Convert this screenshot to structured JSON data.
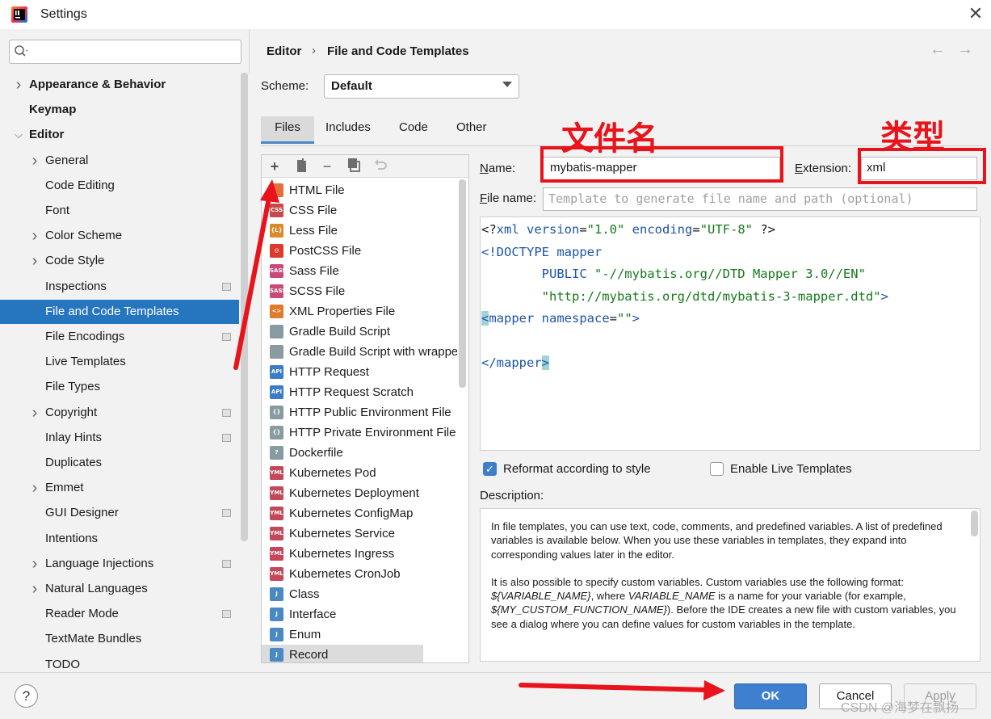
{
  "window": {
    "title": "Settings"
  },
  "search": {
    "placeholder": ""
  },
  "sidebar": {
    "items": [
      {
        "label": "Appearance & Behavior",
        "chevron": true,
        "bold": true,
        "indent": 0,
        "project": false
      },
      {
        "label": "Keymap",
        "chevron": false,
        "bold": true,
        "indent": 0,
        "project": false
      },
      {
        "label": "Editor",
        "chevron": "open",
        "bold": true,
        "indent": 0,
        "project": false
      },
      {
        "label": "General",
        "chevron": true,
        "bold": false,
        "indent": 1,
        "project": false
      },
      {
        "label": "Code Editing",
        "chevron": false,
        "bold": false,
        "indent": 1,
        "project": false
      },
      {
        "label": "Font",
        "chevron": false,
        "bold": false,
        "indent": 1,
        "project": false
      },
      {
        "label": "Color Scheme",
        "chevron": true,
        "bold": false,
        "indent": 1,
        "project": false
      },
      {
        "label": "Code Style",
        "chevron": true,
        "bold": false,
        "indent": 1,
        "project": false
      },
      {
        "label": "Inspections",
        "chevron": false,
        "bold": false,
        "indent": 1,
        "project": true
      },
      {
        "label": "File and Code Templates",
        "chevron": false,
        "bold": false,
        "indent": 1,
        "project": false,
        "selected": true
      },
      {
        "label": "File Encodings",
        "chevron": false,
        "bold": false,
        "indent": 1,
        "project": true
      },
      {
        "label": "Live Templates",
        "chevron": false,
        "bold": false,
        "indent": 1,
        "project": false
      },
      {
        "label": "File Types",
        "chevron": false,
        "bold": false,
        "indent": 1,
        "project": false
      },
      {
        "label": "Copyright",
        "chevron": true,
        "bold": false,
        "indent": 1,
        "project": true
      },
      {
        "label": "Inlay Hints",
        "chevron": false,
        "bold": false,
        "indent": 1,
        "project": true
      },
      {
        "label": "Duplicates",
        "chevron": false,
        "bold": false,
        "indent": 1,
        "project": false
      },
      {
        "label": "Emmet",
        "chevron": true,
        "bold": false,
        "indent": 1,
        "project": false
      },
      {
        "label": "GUI Designer",
        "chevron": false,
        "bold": false,
        "indent": 1,
        "project": true
      },
      {
        "label": "Intentions",
        "chevron": false,
        "bold": false,
        "indent": 1,
        "project": false
      },
      {
        "label": "Language Injections",
        "chevron": true,
        "bold": false,
        "indent": 1,
        "project": true
      },
      {
        "label": "Natural Languages",
        "chevron": true,
        "bold": false,
        "indent": 1,
        "project": false
      },
      {
        "label": "Reader Mode",
        "chevron": false,
        "bold": false,
        "indent": 1,
        "project": true
      },
      {
        "label": "TextMate Bundles",
        "chevron": false,
        "bold": false,
        "indent": 1,
        "project": false
      },
      {
        "label": "TODO",
        "chevron": false,
        "bold": false,
        "indent": 1,
        "project": false
      }
    ]
  },
  "breadcrumb": {
    "parent": "Editor",
    "separator": "›",
    "current": "File and Code Templates"
  },
  "nav": {
    "back": "←",
    "forward": "→"
  },
  "scheme": {
    "label": "Scheme:",
    "value": "Default"
  },
  "tabs": [
    "Files",
    "Includes",
    "Code",
    "Other"
  ],
  "toolbar": {
    "add": "+",
    "remove": "−"
  },
  "templates": [
    {
      "label": "HTML File",
      "icon": "html-file-icon",
      "badge": "",
      "color": "#e4703a"
    },
    {
      "label": "CSS File",
      "icon": "css-file-icon",
      "badge": "CSS",
      "color": "#c74a4a"
    },
    {
      "label": "Less File",
      "icon": "less-file-icon",
      "badge": "{L}",
      "color": "#d98a2b"
    },
    {
      "label": "PostCSS File",
      "icon": "postcss-file-icon",
      "badge": "◎",
      "color": "#dd3a2b"
    },
    {
      "label": "Sass File",
      "icon": "sass-file-icon",
      "badge": "SASS",
      "color": "#c74a7a"
    },
    {
      "label": "SCSS File",
      "icon": "scss-file-icon",
      "badge": "SASS",
      "color": "#c74a7a"
    },
    {
      "label": "XML Properties File",
      "icon": "xml-properties-file-icon",
      "badge": "<>",
      "color": "#e07a2c"
    },
    {
      "label": "Gradle Build Script",
      "icon": "gradle-icon",
      "badge": "",
      "color": "#8a9aa3"
    },
    {
      "label": "Gradle Build Script with wrapper",
      "icon": "gradle-wrapper-icon",
      "badge": "",
      "color": "#8a9aa3"
    },
    {
      "label": "HTTP Request",
      "icon": "http-request-icon",
      "badge": "API",
      "color": "#3b7cc7"
    },
    {
      "label": "HTTP Request Scratch",
      "icon": "http-scratch-icon",
      "badge": "API",
      "color": "#3b7cc7"
    },
    {
      "label": "HTTP Public Environment File",
      "icon": "http-public-env-icon",
      "badge": "{}",
      "color": "#8a9aa3"
    },
    {
      "label": "HTTP Private Environment File",
      "icon": "http-private-env-icon",
      "badge": "{}",
      "color": "#8a9aa3"
    },
    {
      "label": "Dockerfile",
      "icon": "dockerfile-icon",
      "badge": "?",
      "color": "#8a9aa3"
    },
    {
      "label": "Kubernetes Pod",
      "icon": "yaml-file-icon",
      "badge": "YML",
      "color": "#c4485a"
    },
    {
      "label": "Kubernetes Deployment",
      "icon": "yaml-file-icon",
      "badge": "YML",
      "color": "#c4485a"
    },
    {
      "label": "Kubernetes ConfigMap",
      "icon": "yaml-file-icon",
      "badge": "YML",
      "color": "#c4485a"
    },
    {
      "label": "Kubernetes Service",
      "icon": "yaml-file-icon",
      "badge": "YML",
      "color": "#c4485a"
    },
    {
      "label": "Kubernetes Ingress",
      "icon": "yaml-file-icon",
      "badge": "YML",
      "color": "#c4485a"
    },
    {
      "label": "Kubernetes CronJob",
      "icon": "yaml-file-icon",
      "badge": "YML",
      "color": "#c4485a"
    },
    {
      "label": "Class",
      "icon": "java-class-icon",
      "badge": "J",
      "color": "#4a8ac4"
    },
    {
      "label": "Interface",
      "icon": "java-interface-icon",
      "badge": "J",
      "color": "#4a8ac4"
    },
    {
      "label": "Enum",
      "icon": "java-enum-icon",
      "badge": "J",
      "color": "#4a8ac4"
    },
    {
      "label": "Record",
      "icon": "java-record-icon",
      "badge": "J",
      "color": "#4a8ac4",
      "selected": true
    }
  ],
  "form": {
    "name_label": "Name:",
    "name_value": "mybatis-mapper",
    "extension_label": "Extension:",
    "extension_value": "xml",
    "file_name_label": "File name:",
    "file_name_placeholder": "Template to generate file name and path (optional)"
  },
  "code": {
    "line1": {
      "a": "<?",
      "b": "xml version",
      "c": "=",
      "d": "\"1.0\"",
      "e": " encoding",
      "f": "=",
      "g": "\"UTF-8\"",
      "h": " ?>"
    },
    "line2": {
      "a": "<!DOCTYPE mapper"
    },
    "line3": {
      "a": "        PUBLIC ",
      "b": "\"-//mybatis.org//DTD Mapper 3.0//EN\""
    },
    "line4": {
      "a": "        ",
      "b": "\"http://mybatis.org/dtd/mybatis-3-mapper.dtd\"",
      "c": ">"
    },
    "line5": {
      "a": "<",
      "b": "mapper namespace",
      "c": "=",
      "d": "\"\"",
      "e": ">"
    },
    "line6": {
      "a": "</",
      "b": "mapper",
      "c": ">"
    }
  },
  "options": {
    "reformat_label": "Reformat according to style",
    "reformat_checked": true,
    "live_label": "Enable Live Templates",
    "live_checked": false
  },
  "description": {
    "label": "Description:",
    "p1": "In file templates, you can use text, code, comments, and predefined variables. A list of predefined variables is available below. When you use these variables in templates, they expand into corresponding values later in the editor.",
    "p2a": "It is also possible to specify custom variables. Custom variables use the following format: ",
    "p2b": "${VARIABLE_NAME}",
    "p2c": ", where ",
    "p2d": "VARIABLE_NAME",
    "p2e": " is a name for your variable (for example, ",
    "p2f": "${MY_CUSTOM_FUNCTION_NAME}",
    "p2g": "). Before the IDE creates a new file with custom variables, you see a dialog where you can define values for custom variables in the template."
  },
  "buttons": {
    "help": "?",
    "ok": "OK",
    "cancel": "Cancel",
    "apply": "Apply"
  },
  "annotations": {
    "name_note": "文件名",
    "ext_note": "类型"
  },
  "watermark": "CSDN @海梦在飘扬",
  "colors": {
    "selection": "#2675bf",
    "annotation": "#e8141c",
    "ok_button": "#3e7fd0"
  }
}
